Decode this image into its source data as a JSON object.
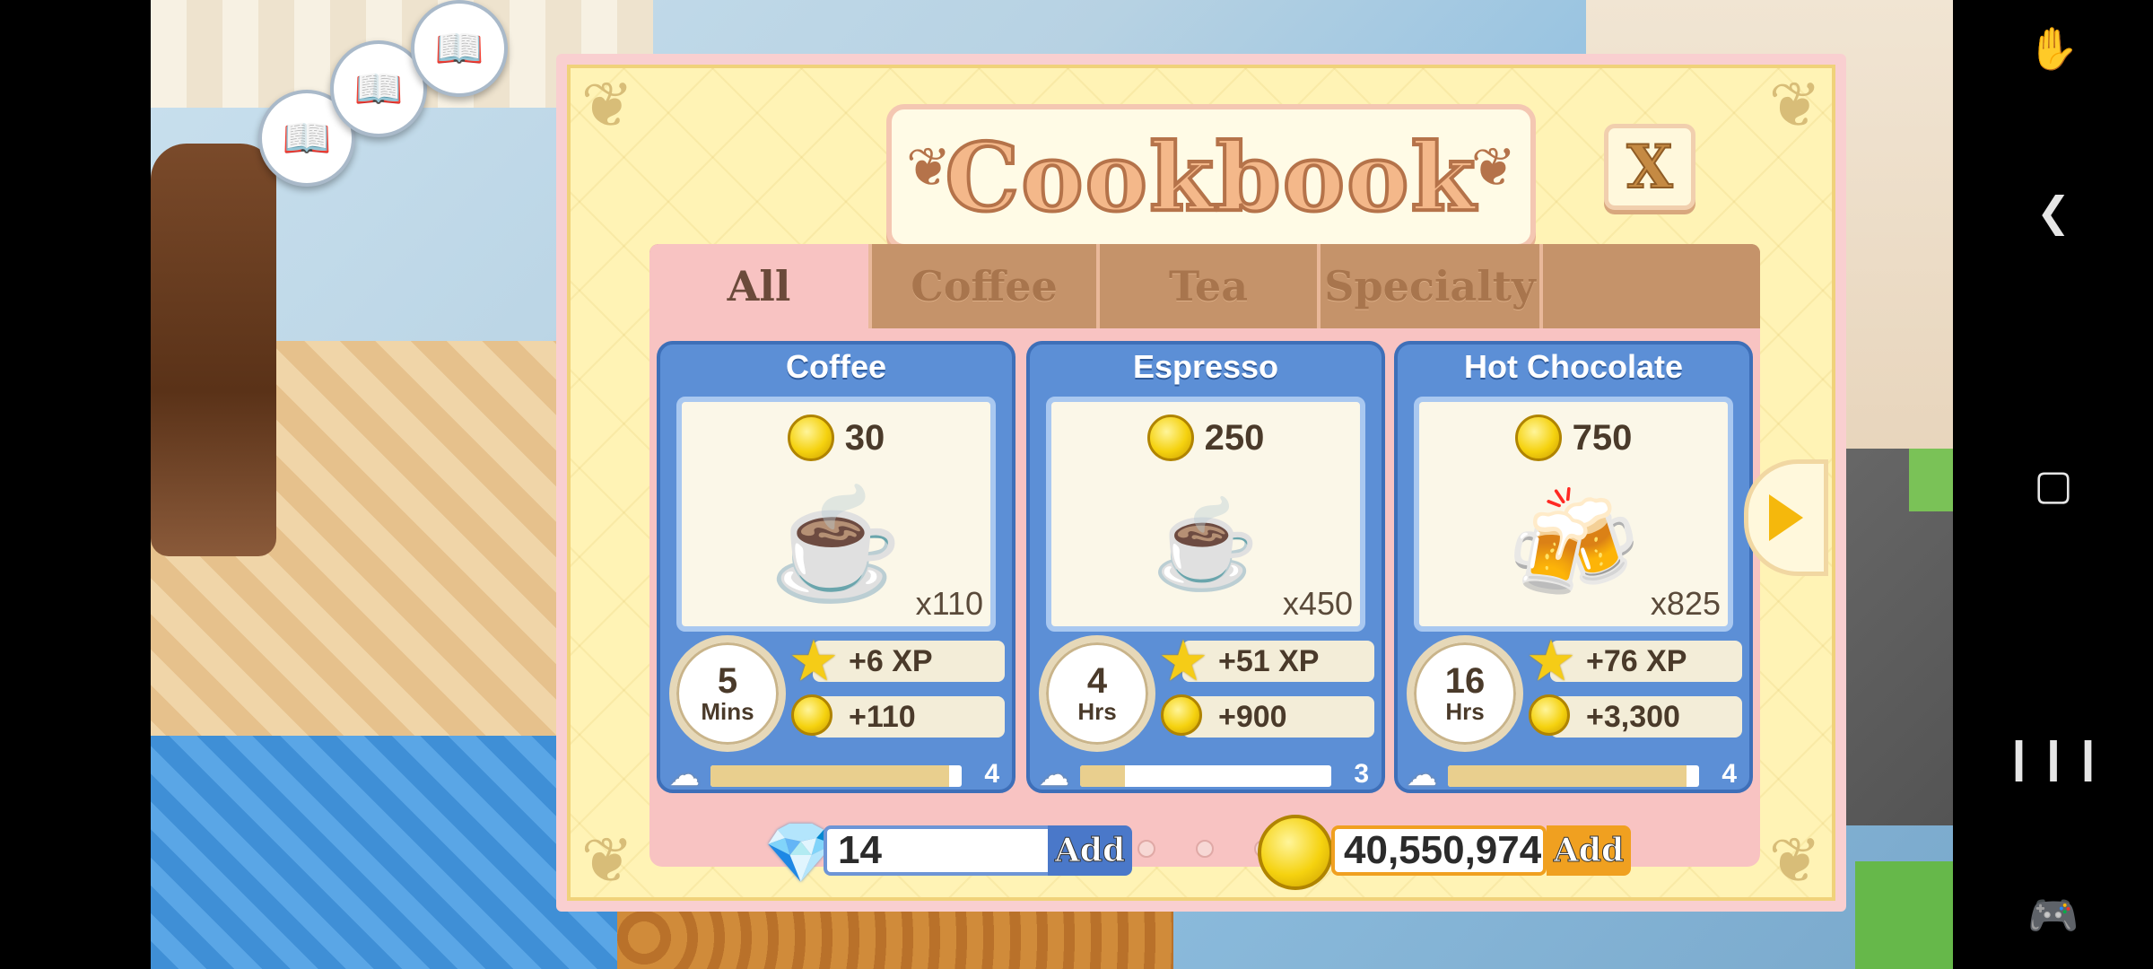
{
  "dialog": {
    "title": "Cookbook",
    "close_label": "X",
    "tabs": [
      {
        "label": "All",
        "active": true
      },
      {
        "label": "Coffee",
        "active": false
      },
      {
        "label": "Tea",
        "active": false
      },
      {
        "label": "Specialty",
        "active": false
      },
      {
        "label": "",
        "active": false
      }
    ],
    "recipes": [
      {
        "name": "Coffee",
        "price": "30",
        "servings": "x110",
        "time_value": "5",
        "time_unit": "Mins",
        "xp": "+6 XP",
        "coins": "+110",
        "level": "4",
        "progress": 0.95,
        "drink_icon": "coffee-cup"
      },
      {
        "name": "Espresso",
        "price": "250",
        "servings": "x450",
        "time_value": "4",
        "time_unit": "Hrs",
        "xp": "+51 XP",
        "coins": "+900",
        "level": "3",
        "progress": 0.18,
        "drink_icon": "espresso-cup"
      },
      {
        "name": "Hot Chocolate",
        "price": "750",
        "servings": "x825",
        "time_value": "16",
        "time_unit": "Hrs",
        "xp": "+76 XP",
        "coins": "+3,300",
        "level": "4",
        "progress": 0.95,
        "drink_icon": "hot-chocolate-glass"
      }
    ],
    "page_count": 11,
    "active_page": 0,
    "gems": {
      "value": "14",
      "add_label": "Add"
    },
    "coins": {
      "value": "40,550,974",
      "add_label": "Add"
    }
  },
  "colors": {
    "card_blue": "#5c8fd6",
    "panel_pink": "#f8c3c2",
    "dialog_yellow": "#fff3b5",
    "gem_add": "#4a78c9",
    "coin_add": "#f0a020"
  },
  "navbar": {
    "icons": [
      "screen-touch-icon",
      "back-icon",
      "home-icon",
      "recents-icon",
      "game-tools-icon"
    ]
  }
}
